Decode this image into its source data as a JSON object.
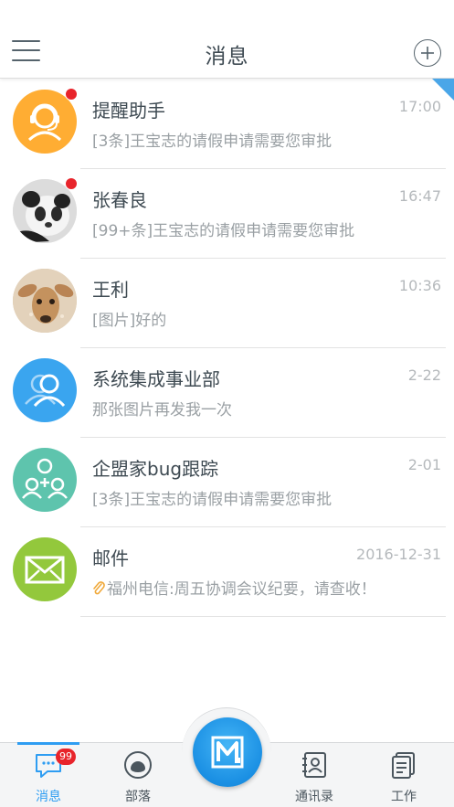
{
  "header": {
    "title": "消息",
    "menu_icon": "hamburger-menu-icon",
    "add_icon": "plus-circle-icon"
  },
  "conversations": [
    {
      "title": "提醒助手",
      "time": "17:00",
      "preview": "[3条]王宝志的请假申请需要您审批",
      "unread_dot": true,
      "avatar": "headset-icon",
      "avatar_color": "#ffad33"
    },
    {
      "title": "张春良",
      "time": "16:47",
      "preview": "[99+条]王宝志的请假申请需要您审批",
      "unread_dot": true,
      "avatar": "panda-photo",
      "avatar_color": "#e6e6e6"
    },
    {
      "title": "王利",
      "time": "10:36",
      "preview": "[图片]好的",
      "unread_dot": false,
      "avatar": "deer-photo",
      "avatar_color": "#c8a07a"
    },
    {
      "title": "系统集成事业部",
      "time": "2-22",
      "preview": "那张图片再发我一次",
      "unread_dot": false,
      "avatar": "group-icon",
      "avatar_color": "#3aa5ef"
    },
    {
      "title": "企盟家bug跟踪",
      "time": "2-01",
      "preview": "[3条]王宝志的请假申请需要您审批",
      "unread_dot": false,
      "avatar": "add-group-icon",
      "avatar_color": "#5ec4ad"
    },
    {
      "title": "邮件",
      "time": "2016-12-31",
      "preview": "福州电信:周五协调会议纪要，请查收！",
      "unread_dot": false,
      "avatar": "envelope-icon",
      "avatar_color": "#93c83c",
      "preview_icon": "paperclip-icon"
    }
  ],
  "tabbar": {
    "tabs": [
      {
        "label": "消息",
        "icon": "chat-icon",
        "active": true,
        "badge": "99"
      },
      {
        "label": "部落",
        "icon": "tribe-icon",
        "active": false
      },
      {
        "label": "通讯录",
        "icon": "contacts-icon",
        "active": false
      },
      {
        "label": "工作",
        "icon": "work-icon",
        "active": false
      }
    ],
    "center_icon": "m-logo-icon"
  },
  "colors": {
    "accent": "#2e9df2",
    "badge": "#e8242b"
  }
}
